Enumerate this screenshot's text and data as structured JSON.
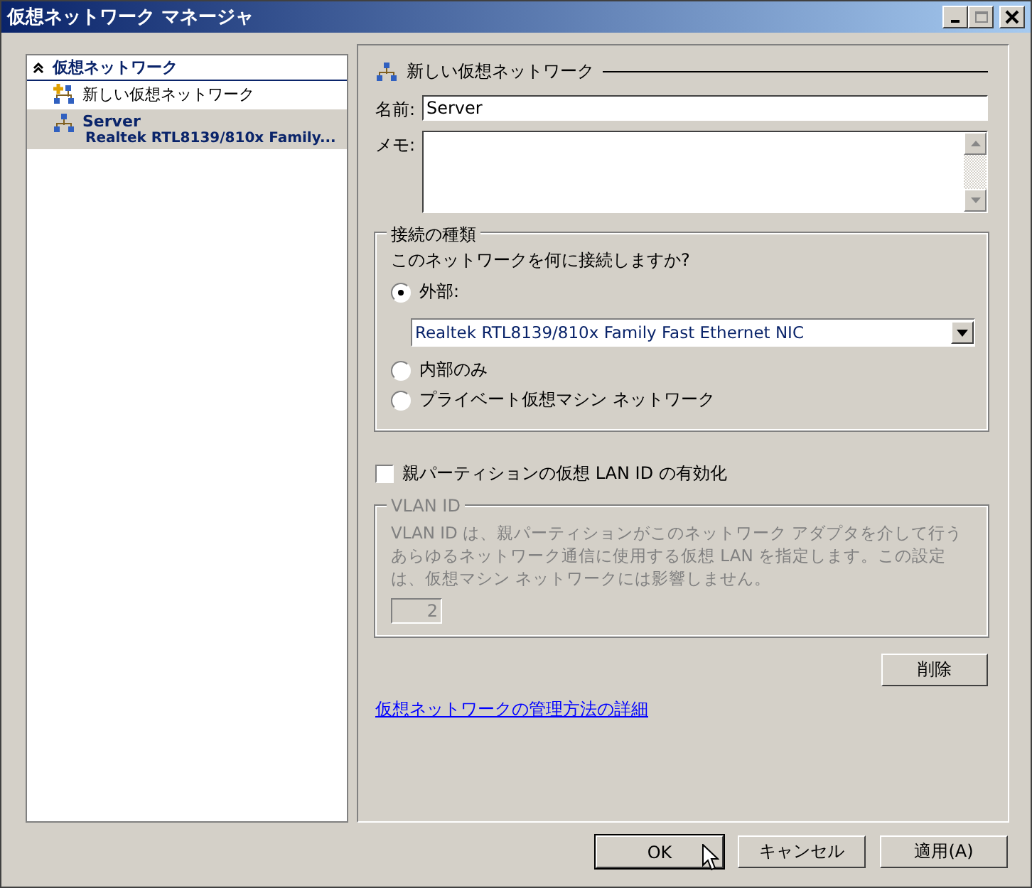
{
  "window": {
    "title": "仮想ネットワーク マネージャ"
  },
  "sidebar": {
    "header": "仮想ネットワーク",
    "expanded": true,
    "items": [
      {
        "kind": "new",
        "label": "新しい仮想ネットワーク",
        "selected": false
      },
      {
        "kind": "network",
        "label": "Server",
        "detail": "Realtek RTL8139/810x Family...",
        "selected": true
      }
    ]
  },
  "panel": {
    "title": "新しい仮想ネットワーク",
    "name_label": "名前:",
    "name_value": "Server",
    "memo_label": "メモ:",
    "connection": {
      "legend": "接続の種類",
      "question": "このネットワークを何に接続しますか?",
      "options": [
        {
          "kind": "adapter",
          "label": "外部:",
          "selected": true,
          "adapter": "Realtek RTL8139/810x Family Fast Ethernet NIC"
        },
        {
          "kind": "plain",
          "label": "内部のみ",
          "selected": false
        },
        {
          "kind": "plain",
          "label": "プライベート仮想マシン ネットワーク",
          "selected": false
        }
      ]
    },
    "vlan_checkbox": {
      "label": "親パーティションの仮想 LAN ID の有効化",
      "checked": false
    },
    "vlan": {
      "legend": "VLAN ID",
      "description": "VLAN ID は、親パーティションがこのネットワーク アダプタを介して行うあらゆるネットワーク通信に使用する仮想 LAN を指定します。この設定は、仮想マシン ネットワークには影響しません。",
      "value": "2",
      "disabled": true
    },
    "delete_button": "削除",
    "link": "仮想ネットワークの管理方法の詳細"
  },
  "buttons": [
    {
      "label": "OK",
      "default": true
    },
    {
      "label": "キャンセル",
      "default": false
    },
    {
      "label": "適用(A)",
      "default": false
    }
  ]
}
